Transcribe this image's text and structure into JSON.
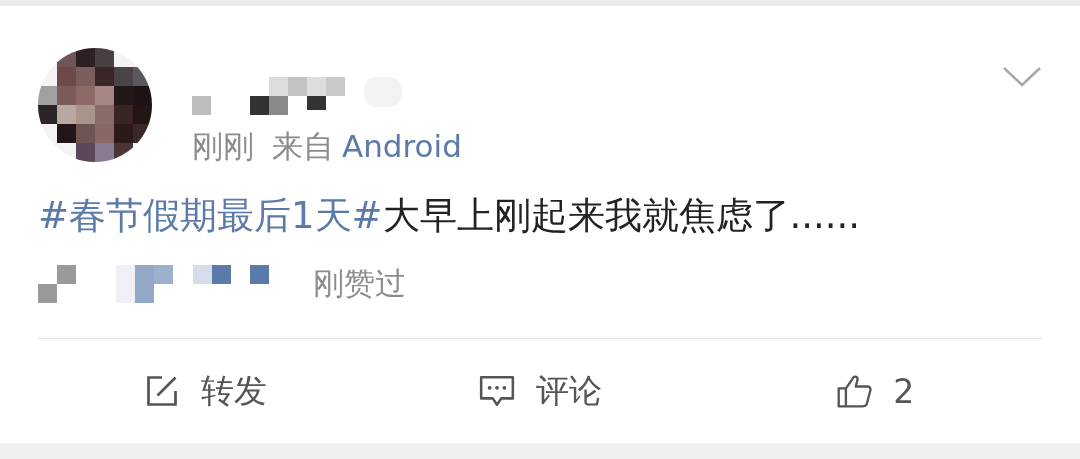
{
  "post": {
    "time": "刚刚",
    "source_prefix": "来自",
    "source": "Android",
    "topic": "#春节假期最后1天#",
    "text": "大早上刚起来我就焦虑了......",
    "liked_by": "刚赞过"
  },
  "actions": [
    {
      "kind": "repost",
      "label": "转发"
    },
    {
      "kind": "comment",
      "label": "评论"
    },
    {
      "kind": "like",
      "label": "2"
    }
  ]
}
